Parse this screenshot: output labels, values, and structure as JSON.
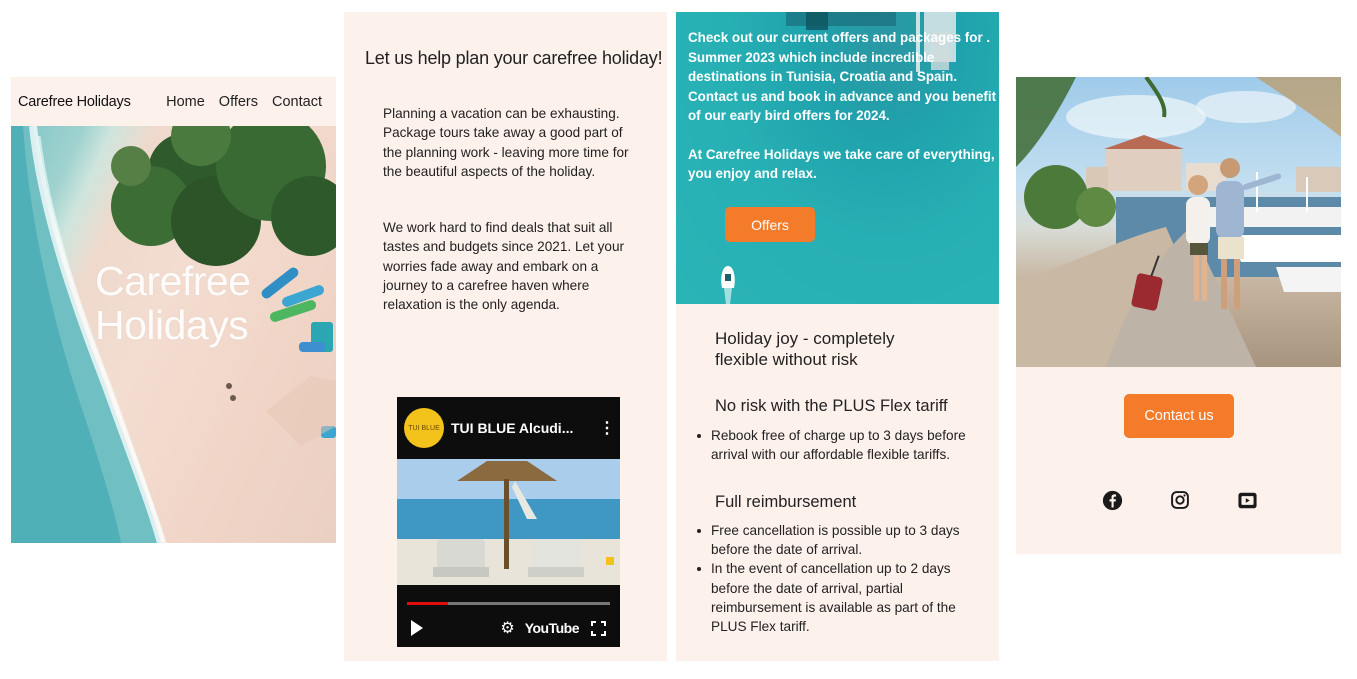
{
  "nav": {
    "brand": "Carefree Holidays",
    "links": [
      "Home",
      "Offers",
      "Contact"
    ]
  },
  "hero": {
    "title_line1": "Carefree",
    "title_line2": "Holidays"
  },
  "intro": {
    "heading": "Let us help plan your carefree holiday!",
    "paragraph1": "Planning a vacation can be exhausting. Package tours take away a good part of the planning work - leaving more time for the beautiful aspects of the holiday.",
    "paragraph2": "We work hard to find deals that suit all tastes and budgets since 2021. Let your worries fade away and embark on a journey to a carefree haven where relaxation is the only agenda."
  },
  "video": {
    "title": "TUI BLUE Alcudi...",
    "logo_text": "TUI BLUE",
    "platform_label": "YouTube",
    "progress": 0.2,
    "icons": [
      "play-icon",
      "settings-gear-icon",
      "fullscreen-icon",
      "more-vertical-icon"
    ]
  },
  "offers": {
    "text1": "Check out our current offers and packages for . Summer 2023 which include incredible destinations in Tunisia, Croatia and Spain. Contact us and book in advance and you benefit of our early bird offers for 2024.",
    "text2": "At Carefree Holidays we take care of everything, you enjoy and relax.",
    "button_label": "Offers"
  },
  "flex": {
    "heading": "Holiday joy - completely flexible without risk",
    "risk_heading": "No risk with the PLUS Flex tariff",
    "risk_items": [
      "Rebook free of charge up to 3 days before arrival with our affordable flexible tariffs."
    ],
    "reimburse_heading": "Full reimbursement",
    "reimburse_items": [
      "Free cancellation is possible up to 3 days before the date of arrival.",
      "In the event of cancellation up to 2 days before the date of arrival, partial reimbursement is available as part of the PLUS Flex tariff."
    ]
  },
  "contact": {
    "button_label": "Contact us",
    "social_icons": [
      "facebook-icon",
      "instagram-icon",
      "youtube-icon"
    ]
  },
  "colors": {
    "background_panel": "#fdf1ec",
    "accent_orange": "#f47b29",
    "sea_teal": "#27b0b4",
    "video_dark": "#0d0d0d",
    "progress_red": "#e20d0d"
  }
}
